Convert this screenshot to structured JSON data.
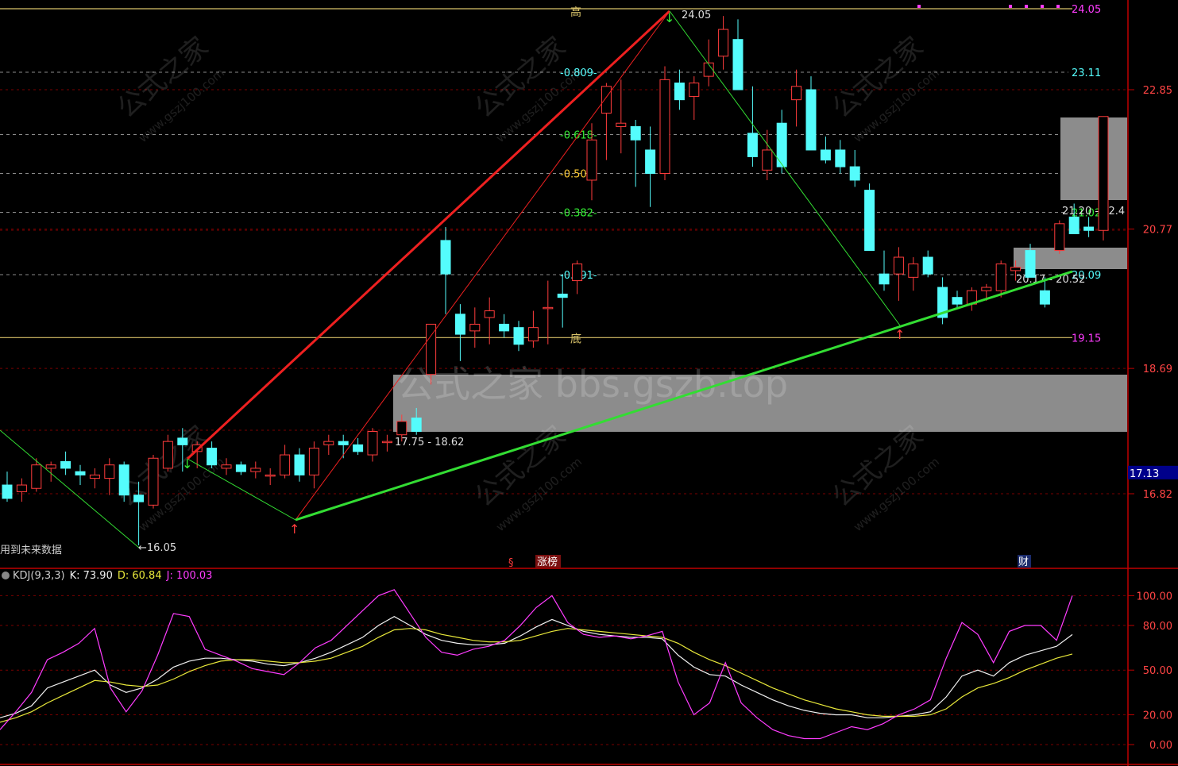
{
  "colors": {
    "bg": "#000000",
    "up": "#ff3c3c",
    "down": "#54fcfc",
    "grid": "#7a0000",
    "axis": "#c00000",
    "fib_line": "#8a8a8a",
    "zone": "#8c8c8c",
    "k_line": "#f0f0f0",
    "d_line": "#e8e83a",
    "j_line": "#ff3cff",
    "top_line": "#d9c36a",
    "uptrend": "#33dd33",
    "rally": "#ee2020"
  },
  "main_axis": {
    "ticks": [
      "22.85",
      "20.77",
      "18.69",
      "16.82"
    ],
    "current_price": "17.13"
  },
  "fib_levels": [
    {
      "ratio": "0.809",
      "price": "23.11",
      "color": "#54fcfc"
    },
    {
      "ratio": "0.618",
      "price": "22.18",
      "color": "#33ee33"
    },
    {
      "ratio": "0.500",
      "price": "21.60",
      "color": "#ffcc33"
    },
    {
      "ratio": "0.382",
      "price": "21.02",
      "color": "#33ee33"
    },
    {
      "ratio": "0.191",
      "price": "20.09",
      "color": "#54fcfc"
    }
  ],
  "top_level": {
    "label": "高",
    "price": "24.05"
  },
  "bottom_level": {
    "label": "底",
    "price": "19.15"
  },
  "annotations": {
    "peak": "24.05",
    "low_start": "←16.05",
    "zone_low": "17.75 - 18.62",
    "zone_mid": "20.17 - 20.52",
    "zone_right": "21.20 - 22.4"
  },
  "markers": {
    "s_flag": "§",
    "limit_up": "涨榜",
    "finance": "财"
  },
  "notice": "用到未来数据",
  "watermark": {
    "site": "公式之家 bbs.gszb.top",
    "brand": "公式之家",
    "url": "www.gszj100.com"
  },
  "kdj": {
    "name": "KDJ(9,3,3)",
    "k_label": "K: 73.90",
    "d_label": "D: 60.84",
    "j_label": "J: 100.03",
    "axis_ticks": [
      "100.00",
      "80.00",
      "50.00",
      "20.00",
      "0.00"
    ]
  },
  "chart_data": [
    {
      "type": "candlestick",
      "title": "",
      "ylim": [
        16.0,
        24.4
      ],
      "candles": [
        {
          "o": 16.95,
          "h": 17.15,
          "l": 16.7,
          "c": 16.75
        },
        {
          "o": 16.85,
          "h": 17.05,
          "l": 16.7,
          "c": 16.95
        },
        {
          "o": 16.9,
          "h": 17.35,
          "l": 16.85,
          "c": 17.25
        },
        {
          "o": 17.2,
          "h": 17.3,
          "l": 17.0,
          "c": 17.25
        },
        {
          "o": 17.3,
          "h": 17.45,
          "l": 17.1,
          "c": 17.2
        },
        {
          "o": 17.15,
          "h": 17.25,
          "l": 16.95,
          "c": 17.1
        },
        {
          "o": 17.05,
          "h": 17.2,
          "l": 16.9,
          "c": 17.1
        },
        {
          "o": 17.05,
          "h": 17.35,
          "l": 16.8,
          "c": 17.25
        },
        {
          "o": 17.25,
          "h": 17.3,
          "l": 16.7,
          "c": 16.8
        },
        {
          "o": 16.8,
          "h": 17.0,
          "l": 16.05,
          "c": 16.7
        },
        {
          "o": 16.65,
          "h": 17.4,
          "l": 16.6,
          "c": 17.35
        },
        {
          "o": 17.2,
          "h": 17.7,
          "l": 17.15,
          "c": 17.6
        },
        {
          "o": 17.65,
          "h": 17.8,
          "l": 17.15,
          "c": 17.55
        },
        {
          "o": 17.45,
          "h": 17.6,
          "l": 17.2,
          "c": 17.55
        },
        {
          "o": 17.5,
          "h": 17.6,
          "l": 17.2,
          "c": 17.25
        },
        {
          "o": 17.2,
          "h": 17.35,
          "l": 17.1,
          "c": 17.25
        },
        {
          "o": 17.25,
          "h": 17.3,
          "l": 17.1,
          "c": 17.15
        },
        {
          "o": 17.15,
          "h": 17.3,
          "l": 17.05,
          "c": 17.2
        },
        {
          "o": 17.1,
          "h": 17.2,
          "l": 16.95,
          "c": 17.1
        },
        {
          "o": 17.1,
          "h": 17.55,
          "l": 17.05,
          "c": 17.4
        },
        {
          "o": 17.4,
          "h": 17.5,
          "l": 17.0,
          "c": 17.1
        },
        {
          "o": 17.1,
          "h": 17.6,
          "l": 16.9,
          "c": 17.5
        },
        {
          "o": 17.55,
          "h": 17.7,
          "l": 17.4,
          "c": 17.6
        },
        {
          "o": 17.6,
          "h": 17.7,
          "l": 17.35,
          "c": 17.55
        },
        {
          "o": 17.55,
          "h": 17.65,
          "l": 17.4,
          "c": 17.45
        },
        {
          "o": 17.4,
          "h": 17.8,
          "l": 17.3,
          "c": 17.75
        },
        {
          "o": 17.6,
          "h": 17.7,
          "l": 17.45,
          "c": 17.6
        },
        {
          "o": 17.7,
          "h": 18.0,
          "l": 17.6,
          "c": 17.9
        },
        {
          "o": 17.95,
          "h": 18.1,
          "l": 17.7,
          "c": 17.75
        },
        {
          "o": 18.6,
          "h": 19.35,
          "l": 18.45,
          "c": 19.35
        },
        {
          "o": 20.6,
          "h": 20.8,
          "l": 19.5,
          "c": 20.1
        },
        {
          "o": 19.5,
          "h": 19.65,
          "l": 18.8,
          "c": 19.2
        },
        {
          "o": 19.25,
          "h": 19.6,
          "l": 19.0,
          "c": 19.35
        },
        {
          "o": 19.45,
          "h": 19.75,
          "l": 19.05,
          "c": 19.55
        },
        {
          "o": 19.35,
          "h": 19.5,
          "l": 19.15,
          "c": 19.25
        },
        {
          "o": 19.3,
          "h": 19.4,
          "l": 18.95,
          "c": 19.05
        },
        {
          "o": 19.1,
          "h": 19.55,
          "l": 19.0,
          "c": 19.3
        },
        {
          "o": 19.6,
          "h": 20.0,
          "l": 19.05,
          "c": 19.6
        },
        {
          "o": 19.8,
          "h": 20.1,
          "l": 19.3,
          "c": 19.75
        },
        {
          "o": 20.0,
          "h": 20.3,
          "l": 19.8,
          "c": 20.25
        },
        {
          "o": 21.5,
          "h": 22.35,
          "l": 21.2,
          "c": 22.1
        },
        {
          "o": 22.5,
          "h": 22.95,
          "l": 21.8,
          "c": 22.9
        },
        {
          "o": 22.3,
          "h": 23.0,
          "l": 21.9,
          "c": 22.35
        },
        {
          "o": 22.3,
          "h": 22.4,
          "l": 21.4,
          "c": 22.1
        },
        {
          "o": 21.95,
          "h": 22.3,
          "l": 21.1,
          "c": 21.6
        },
        {
          "o": 21.6,
          "h": 23.2,
          "l": 21.5,
          "c": 23.0
        },
        {
          "o": 22.95,
          "h": 23.15,
          "l": 22.55,
          "c": 22.7
        },
        {
          "o": 22.75,
          "h": 23.05,
          "l": 22.4,
          "c": 22.95
        },
        {
          "o": 23.05,
          "h": 23.6,
          "l": 22.9,
          "c": 23.25
        },
        {
          "o": 23.35,
          "h": 23.95,
          "l": 23.15,
          "c": 23.75
        },
        {
          "o": 23.6,
          "h": 23.9,
          "l": 23.05,
          "c": 22.85
        },
        {
          "o": 22.2,
          "h": 22.9,
          "l": 21.7,
          "c": 21.85
        },
        {
          "o": 21.65,
          "h": 22.25,
          "l": 21.5,
          "c": 21.95
        },
        {
          "o": 22.35,
          "h": 22.55,
          "l": 21.6,
          "c": 21.7
        },
        {
          "o": 22.7,
          "h": 23.15,
          "l": 22.3,
          "c": 22.9
        },
        {
          "o": 22.85,
          "h": 23.05,
          "l": 22.05,
          "c": 21.95
        },
        {
          "o": 21.95,
          "h": 22.15,
          "l": 21.75,
          "c": 21.8
        },
        {
          "o": 21.95,
          "h": 22.1,
          "l": 21.6,
          "c": 21.7
        },
        {
          "o": 21.7,
          "h": 21.95,
          "l": 21.4,
          "c": 21.5
        },
        {
          "o": 21.35,
          "h": 21.45,
          "l": 20.6,
          "c": 20.45
        },
        {
          "o": 20.1,
          "h": 20.45,
          "l": 19.85,
          "c": 19.95
        },
        {
          "o": 20.1,
          "h": 20.5,
          "l": 19.7,
          "c": 20.35
        },
        {
          "o": 20.05,
          "h": 20.35,
          "l": 19.85,
          "c": 20.25
        },
        {
          "o": 20.35,
          "h": 20.45,
          "l": 20.05,
          "c": 20.1
        },
        {
          "o": 19.9,
          "h": 20.05,
          "l": 19.35,
          "c": 19.45
        },
        {
          "o": 19.75,
          "h": 19.85,
          "l": 19.6,
          "c": 19.65
        },
        {
          "o": 19.65,
          "h": 19.9,
          "l": 19.55,
          "c": 19.85
        },
        {
          "o": 19.85,
          "h": 19.95,
          "l": 19.7,
          "c": 19.9
        },
        {
          "o": 19.85,
          "h": 20.3,
          "l": 19.75,
          "c": 20.25
        },
        {
          "o": 20.15,
          "h": 20.3,
          "l": 20.0,
          "c": 20.2
        },
        {
          "o": 20.45,
          "h": 20.55,
          "l": 20.05,
          "c": 20.05
        },
        {
          "o": 19.85,
          "h": 20.05,
          "l": 19.6,
          "c": 19.65
        },
        {
          "o": 20.45,
          "h": 20.9,
          "l": 20.4,
          "c": 20.85
        },
        {
          "o": 20.95,
          "h": 21.15,
          "l": 20.75,
          "c": 20.7
        },
        {
          "o": 20.8,
          "h": 20.95,
          "l": 20.65,
          "c": 20.75
        },
        {
          "o": 20.75,
          "h": 22.2,
          "l": 20.6,
          "c": 22.45
        }
      ]
    },
    {
      "type": "line",
      "title": "KDJ(9,3,3)",
      "ylim": [
        0,
        105
      ],
      "series": [
        {
          "name": "K",
          "values": [
            18,
            21,
            26,
            38,
            42,
            46,
            50,
            40,
            35,
            38,
            44,
            52,
            56,
            58,
            58,
            57,
            56,
            54,
            53,
            55,
            58,
            62,
            67,
            72,
            80,
            86,
            80,
            74,
            70,
            68,
            67,
            67,
            68,
            73,
            79,
            84,
            80,
            76,
            74,
            73,
            72,
            72,
            71,
            60,
            52,
            47,
            46,
            40,
            35,
            30,
            26,
            23,
            21,
            20,
            20,
            18,
            18,
            19,
            20,
            22,
            32,
            46,
            50,
            46,
            55,
            60,
            63,
            66,
            73.9
          ]
        },
        {
          "name": "D",
          "values": [
            15,
            18,
            22,
            28,
            33,
            38,
            43,
            42,
            40,
            39,
            40,
            44,
            49,
            53,
            56,
            57,
            57,
            56,
            55,
            55,
            56,
            58,
            62,
            66,
            72,
            77,
            78,
            77,
            74,
            72,
            70,
            69,
            69,
            70,
            73,
            76,
            78,
            77,
            76,
            75,
            74,
            73,
            72,
            68,
            62,
            57,
            53,
            48,
            43,
            38,
            34,
            30,
            27,
            24,
            22,
            20,
            19,
            19,
            19,
            20,
            24,
            32,
            38,
            41,
            45,
            50,
            54,
            58,
            60.84
          ]
        },
        {
          "name": "J",
          "values": [
            10,
            22,
            35,
            57,
            62,
            68,
            78,
            38,
            22,
            36,
            60,
            88,
            86,
            64,
            60,
            56,
            51,
            49,
            47,
            55,
            65,
            70,
            80,
            90,
            100,
            104,
            88,
            72,
            62,
            60,
            64,
            66,
            70,
            80,
            92,
            100,
            82,
            74,
            72,
            73,
            71,
            73,
            76,
            42,
            20,
            28,
            55,
            28,
            18,
            10,
            6,
            4,
            4,
            8,
            12,
            10,
            14,
            20,
            24,
            30,
            58,
            82,
            74,
            55,
            76,
            80,
            80,
            70,
            100.03
          ]
        }
      ]
    }
  ]
}
